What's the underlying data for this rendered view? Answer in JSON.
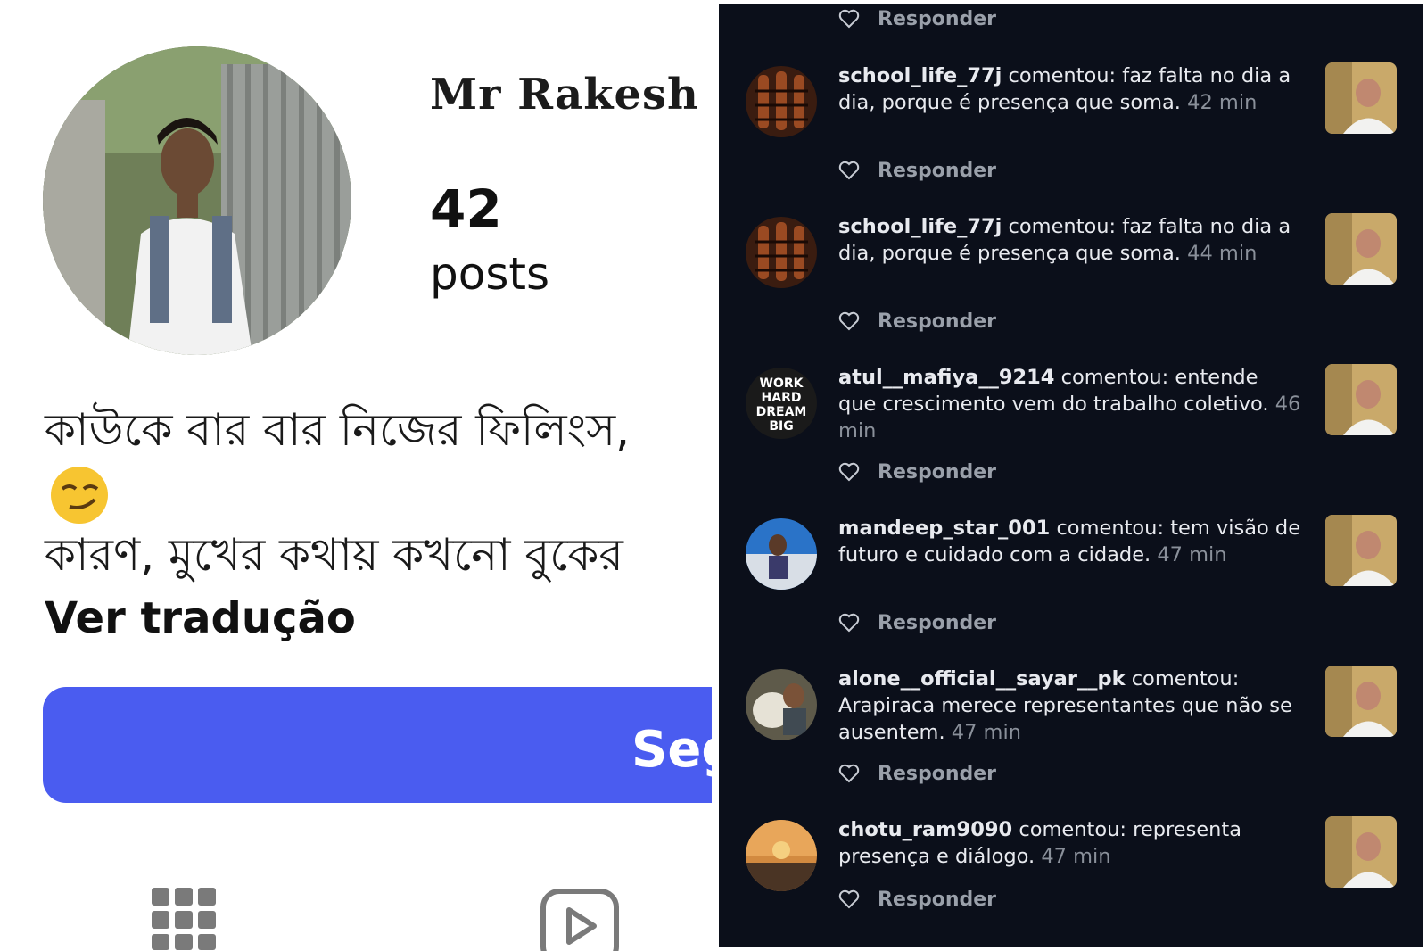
{
  "profile": {
    "name": "Mr Rakesh",
    "posts_count": "42",
    "posts_label": "posts",
    "bio_line1": "কাউকে বার বার নিজের ফিলিংস,",
    "bio_emoji": "😏",
    "bio_line3": "কারণ, মুখের কথায় কখনো বুকের",
    "translate_link": "Ver tradução",
    "follow_button": "Seg"
  },
  "comments": [
    {
      "user": "school_life_77j",
      "verb": "comentou:",
      "text": "faz falta no dia a dia, porque é presença que soma.",
      "time": "42 min",
      "reply": "Responder",
      "avatar": "brown-avatar"
    },
    {
      "user": "school_life_77j",
      "verb": "comentou:",
      "text": "faz falta no dia a dia, porque é presença que soma.",
      "time": "44 min",
      "reply": "Responder",
      "avatar": "brown-avatar"
    },
    {
      "user": "atul__mafiya__9214",
      "verb": "comentou:",
      "text": "entende que crescimento vem do trabalho coletivo.",
      "time": "46 min",
      "reply": "Responder",
      "avatar": "work-hard-avatar"
    },
    {
      "user": "mandeep_star_001",
      "verb": "comentou:",
      "text": "tem visão de futuro e cuidado com a cidade.",
      "time": "47 min",
      "reply": "Responder",
      "avatar": "blue-avatar"
    },
    {
      "user": "alone__official__sayar__pk",
      "verb": "comentou:",
      "text": "Arapiraca merece representantes que não se ausentem.",
      "time": "47 min",
      "reply": "Responder",
      "avatar": "animal-avatar"
    },
    {
      "user": "chotu_ram9090",
      "verb": "comentou:",
      "text": "representa presença e diálogo.",
      "time": "47 min",
      "reply": "Responder",
      "avatar": "sunset-avatar"
    }
  ],
  "top_reply": "Responder",
  "avatar_text": [
    "WORK",
    "HARD",
    "DREAM",
    "BIG"
  ],
  "colors": {
    "follow_button": "#4a5cf0",
    "dark_bg": "#0b0f1a"
  }
}
